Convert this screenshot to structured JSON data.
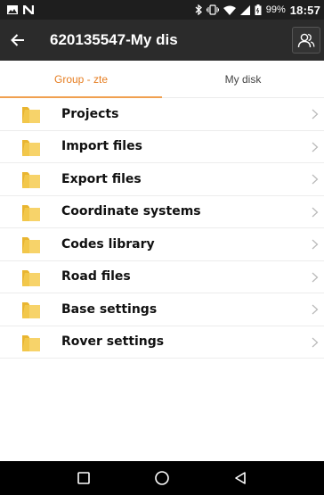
{
  "status_bar": {
    "battery_percent": "99%",
    "time": "18:57",
    "icons": [
      "image-icon",
      "n-notification-icon",
      "bluetooth-icon",
      "vibrate-icon",
      "wifi-icon",
      "signal-icon",
      "battery-icon"
    ]
  },
  "header": {
    "title": "620135547-My dis",
    "back_icon": "arrow-left-icon",
    "profile_icon": "users-icon"
  },
  "tabs": [
    {
      "label": "Group - zte",
      "active": true
    },
    {
      "label": "My disk",
      "active": false
    }
  ],
  "folders": [
    {
      "label": "Projects"
    },
    {
      "label": "Import files"
    },
    {
      "label": "Export files"
    },
    {
      "label": "Coordinate systems"
    },
    {
      "label": "Codes library"
    },
    {
      "label": "Road files"
    },
    {
      "label": "Base settings"
    },
    {
      "label": "Rover settings"
    }
  ],
  "colors": {
    "accent": "#e67e22",
    "folder": "#f2c74a",
    "title_bar": "#2b2b2b",
    "status_bar": "#1e1e1e",
    "nav_bar": "#000000"
  },
  "nav": [
    "recent-apps-icon",
    "home-icon",
    "back-triangle-icon"
  ]
}
